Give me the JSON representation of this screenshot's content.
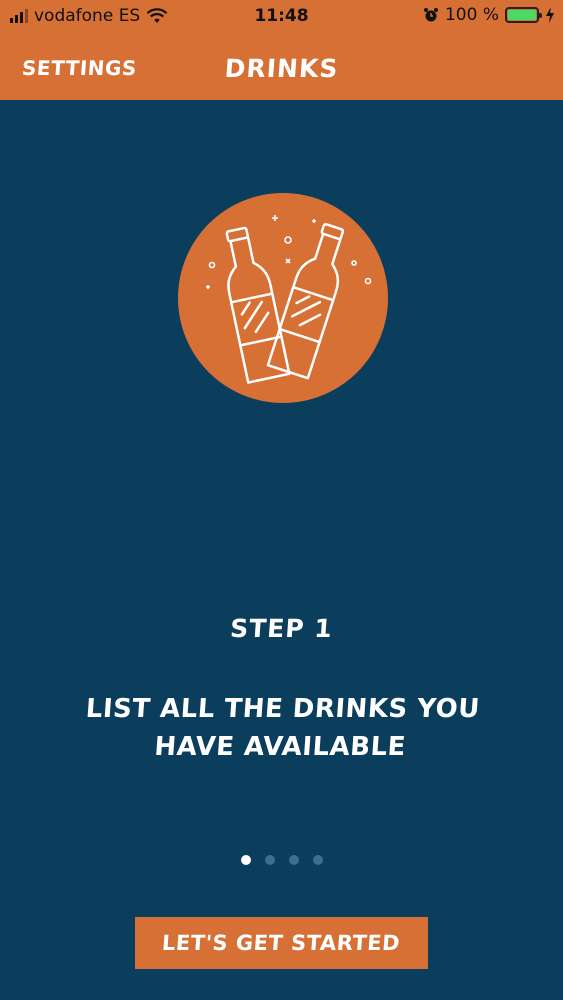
{
  "status_bar": {
    "carrier": "vodafone ES",
    "time": "11:48",
    "battery_percent": "100 %",
    "battery_level": 1.0,
    "signal_bars": 3,
    "signal_bars_total": 4
  },
  "nav": {
    "settings_label": "SETTINGS",
    "title": "DRINKS"
  },
  "onboarding": {
    "illustration_icon": "bottles-icon",
    "step_label": "STEP 1",
    "description_line1": "LIST ALL THE DRINKS YOU",
    "description_line2": "HAVE AVAILABLE",
    "page_count": 4,
    "current_page": 1
  },
  "cta": {
    "label": "LET'S GET STARTED"
  },
  "colors": {
    "accent": "#d77035",
    "background": "#0b3e5d",
    "dot_inactive": "#3f6f8c",
    "dot_active": "#ffffff",
    "battery_fill": "#4cd964"
  }
}
